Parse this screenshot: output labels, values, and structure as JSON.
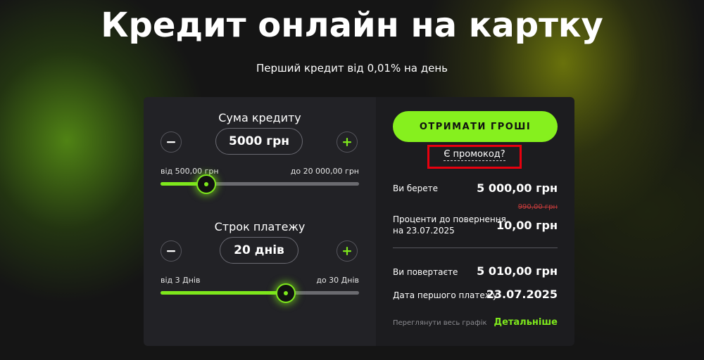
{
  "hero": {
    "title": "Кредит онлайн на картку",
    "subtitle": "Перший кредит від 0,01% на день"
  },
  "amount": {
    "title": "Сума кредиту",
    "value": "5000 грн",
    "min_label": "від 500,00 грн",
    "max_label": "до 20 000,00 грн",
    "min": 500,
    "max": 20000,
    "current": 5000
  },
  "term": {
    "title": "Строк платежу",
    "value": "20 днів",
    "min_label": "від 3 Днів",
    "max_label": "до 30 Днів",
    "min": 3,
    "max": 30,
    "current": 20
  },
  "summary": {
    "cta_label": "ОТРИМАТИ ГРОШІ",
    "promo_label": "Є промокод?",
    "take_label": "Ви берете",
    "take_value": "5 000,00 грн",
    "interest_label_line1": "Проценти до повернення",
    "interest_label_line2": "на 23.07.2025",
    "interest_old_value": "990,00 грн",
    "interest_value": "10,00 грн",
    "return_label": "Ви повертаєте",
    "return_value": "5 010,00 грн",
    "first_payment_label": "Дата першого платежу",
    "first_payment_value": "23.07.2025",
    "schedule_label": "Переглянути весь графік",
    "details_label": "Детальніше"
  },
  "colors": {
    "accent": "#7ee81c",
    "promo_highlight": "#e8000e"
  },
  "icons": [
    "minus-icon",
    "plus-icon"
  ]
}
